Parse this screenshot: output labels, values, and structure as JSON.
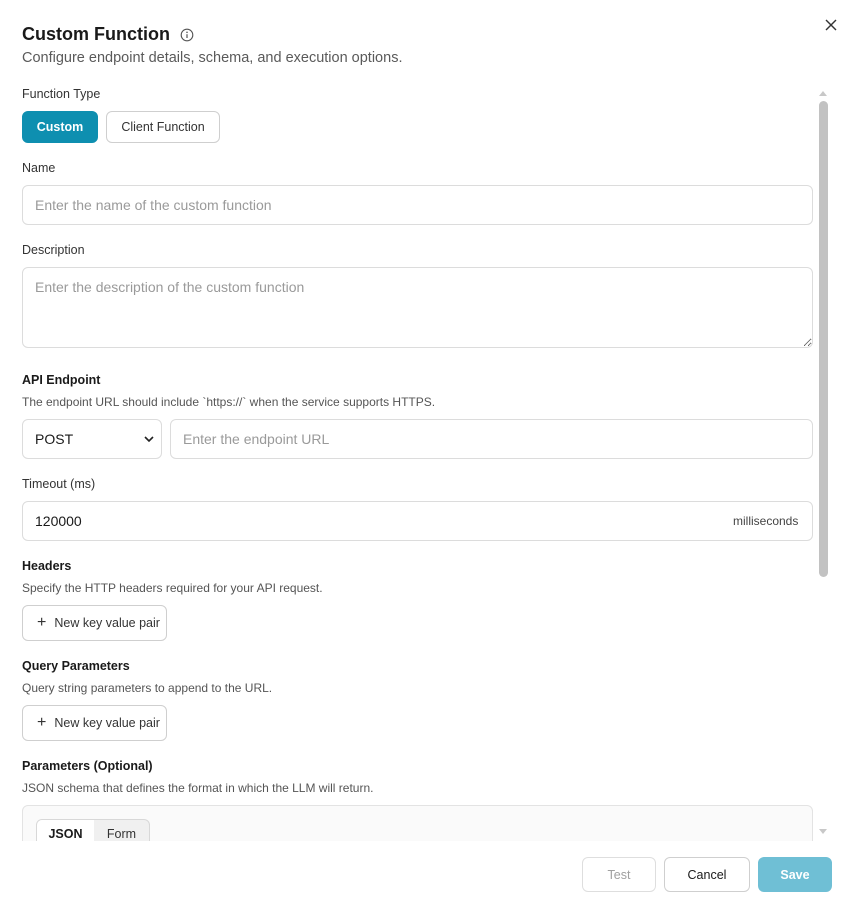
{
  "header": {
    "title": "Custom Function",
    "subtitle": "Configure endpoint details, schema, and execution options."
  },
  "function_type": {
    "label": "Function Type",
    "options": [
      "Custom",
      "Client Function"
    ],
    "selected": "Custom"
  },
  "name": {
    "label": "Name",
    "placeholder": "Enter the name of the custom function",
    "value": ""
  },
  "description": {
    "label": "Description",
    "placeholder": "Enter the description of the custom function",
    "value": ""
  },
  "api_endpoint": {
    "label": "API Endpoint",
    "hint": "The endpoint URL should include `https://` when the service supports HTTPS.",
    "method": "POST",
    "url_placeholder": "Enter the endpoint URL",
    "url_value": ""
  },
  "timeout": {
    "label": "Timeout (ms)",
    "value": "120000",
    "suffix": "milliseconds"
  },
  "headers": {
    "label": "Headers",
    "hint": "Specify the HTTP headers required for your API request.",
    "add_label": "New key value pair"
  },
  "query_parameters": {
    "label": "Query Parameters",
    "hint": "Query string parameters to append to the URL.",
    "add_label": "New key value pair"
  },
  "parameters": {
    "label": "Parameters (Optional)",
    "hint": "JSON schema that defines the format in which the LLM will return.",
    "modes": [
      "JSON",
      "Form"
    ],
    "selected_mode": "JSON"
  },
  "footer": {
    "test_label": "Test",
    "cancel_label": "Cancel",
    "save_label": "Save"
  },
  "colors": {
    "accent": "#0e8fb0",
    "save_disabled": "#6fbfd5"
  },
  "icons": {
    "close": "close-icon",
    "info": "info-icon",
    "plus": "plus-icon",
    "chevron": "chevron-down-icon"
  }
}
